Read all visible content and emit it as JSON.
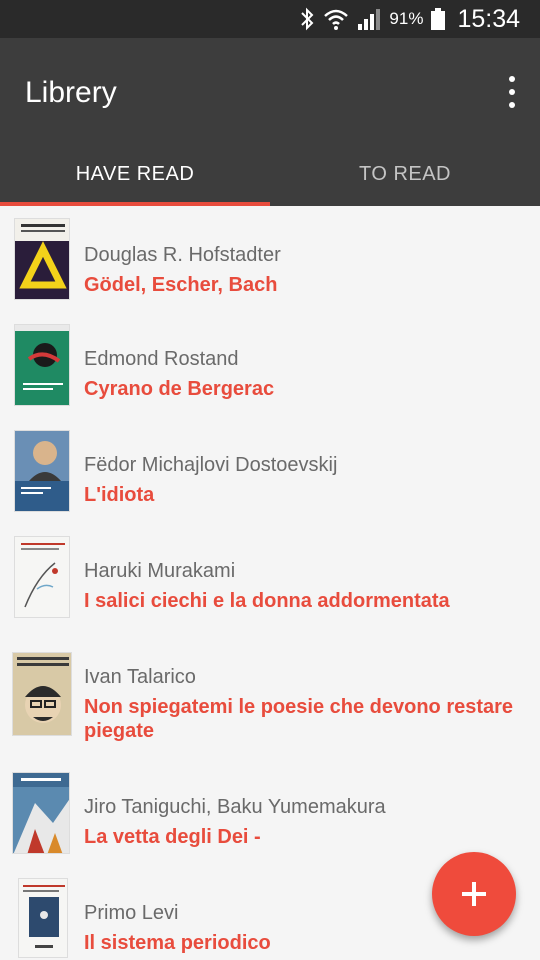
{
  "status": {
    "battery_pct": "91%",
    "time": "15:34"
  },
  "app": {
    "title": "Librery",
    "tabs": [
      {
        "label": "HAVE READ"
      },
      {
        "label": "TO READ"
      }
    ]
  },
  "books": [
    {
      "author": "Douglas R. Hofstadter",
      "title": "Gödel, Escher, Bach"
    },
    {
      "author": "Edmond Rostand",
      "title": "Cyrano de Bergerac"
    },
    {
      "author": "Fëdor Michajlovi Dostoevskij",
      "title": "L'idiota"
    },
    {
      "author": "Haruki Murakami",
      "title": "I salici ciechi e la donna addormentata"
    },
    {
      "author": "Ivan Talarico",
      "title": "Non spiegatemi le poesie che devono restare piegate"
    },
    {
      "author": "Jiro Taniguchi, Baku Yumemakura",
      "title": "La vetta degli Dei -"
    },
    {
      "author": "Primo Levi",
      "title": "Il sistema periodico"
    }
  ],
  "fab": {
    "label": "+"
  },
  "colors": {
    "accent": "#e84c3d",
    "appbar": "#3d3d3d",
    "statusbar": "#2a2a2a"
  },
  "icons": [
    "bluetooth-icon",
    "wifi-icon",
    "signal-icon",
    "battery-icon",
    "overflow-menu-icon",
    "add-icon"
  ]
}
